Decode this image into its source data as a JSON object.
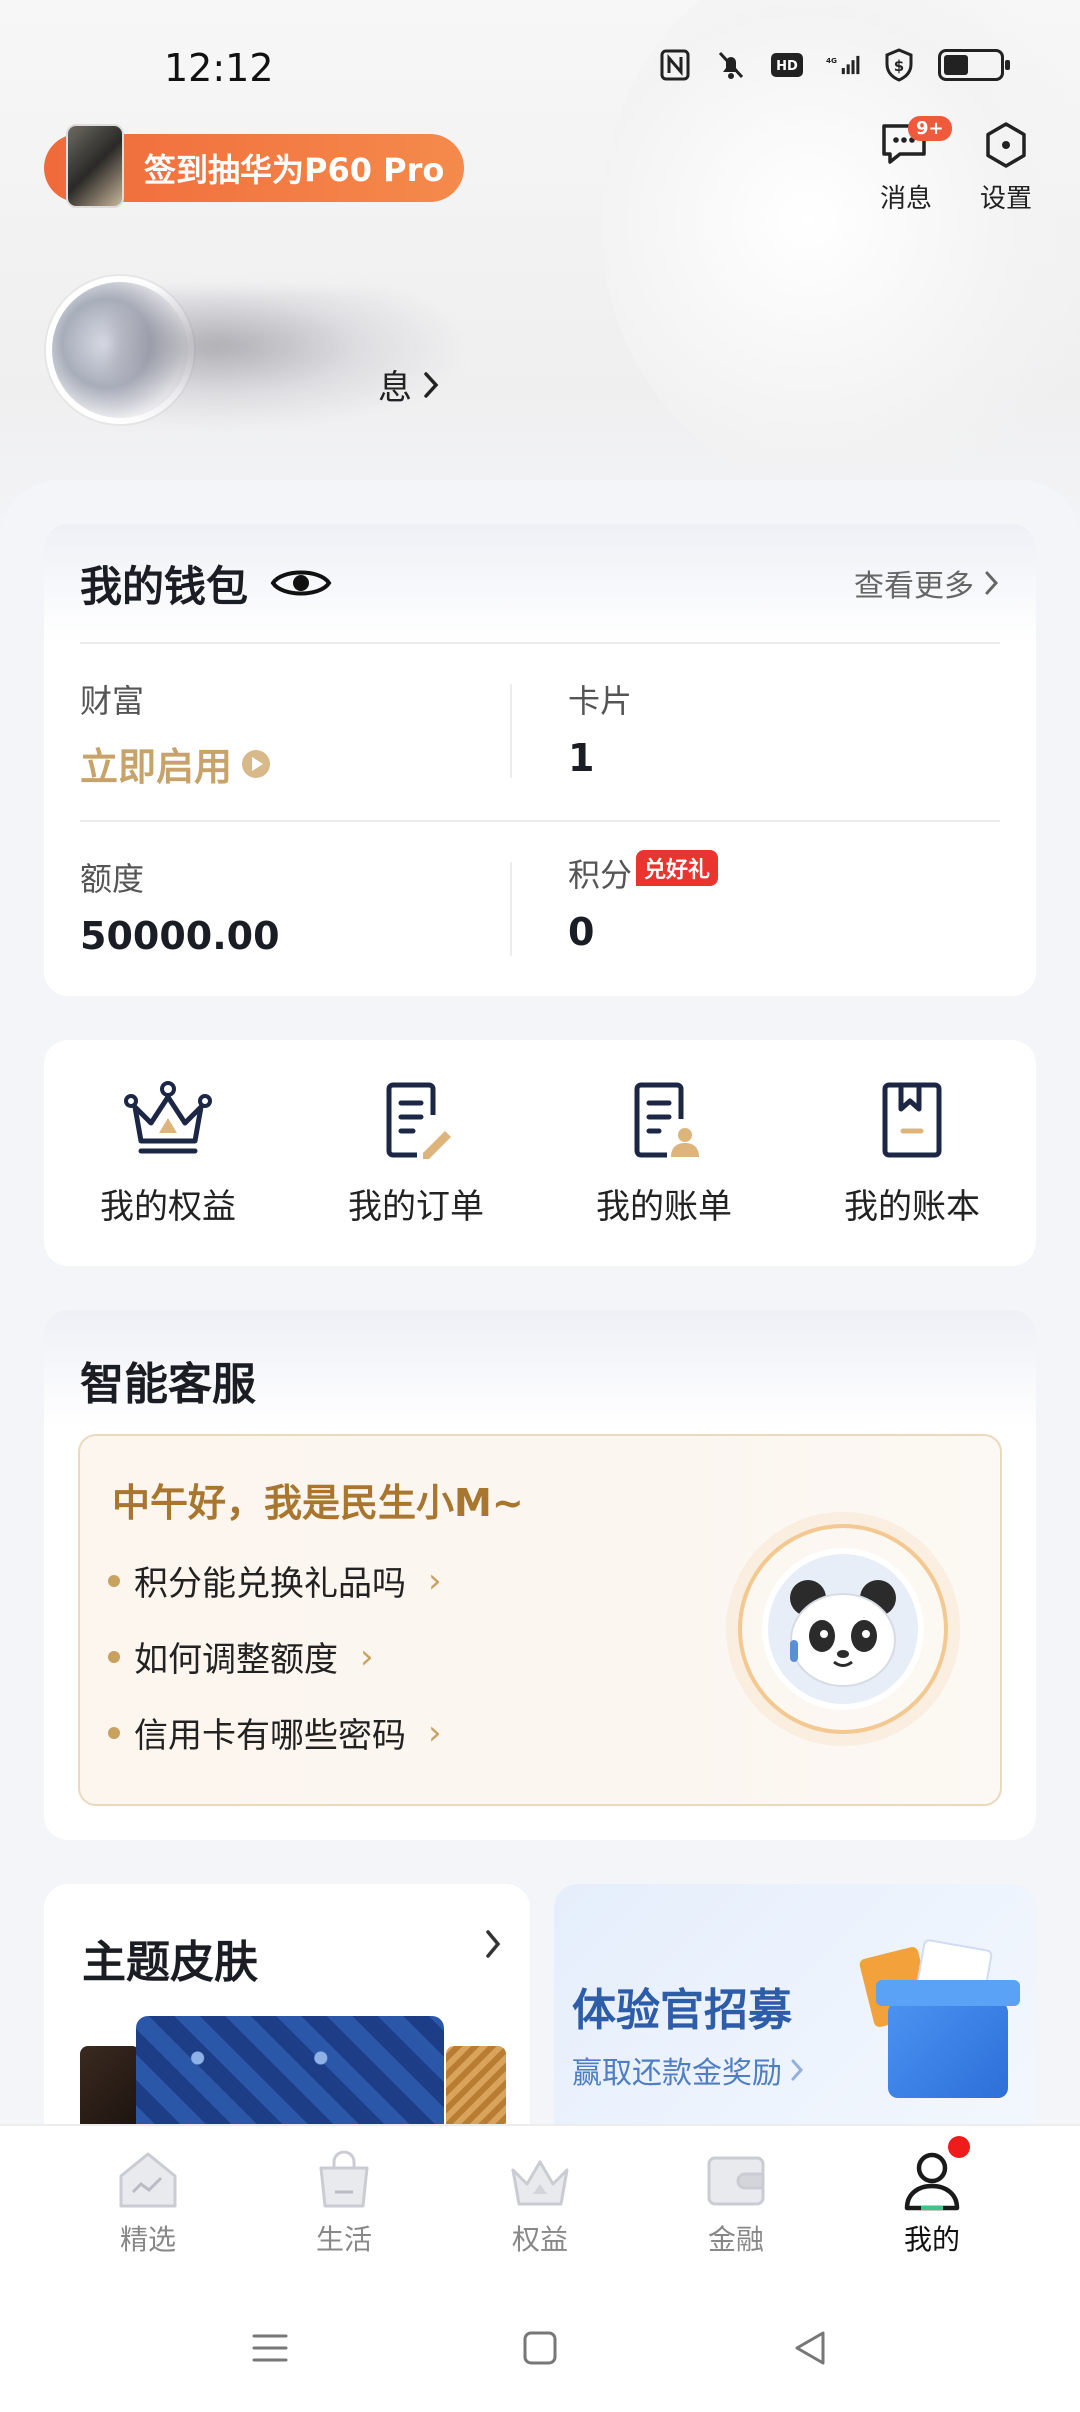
{
  "status_bar": {
    "time": "12:12",
    "network": "4G"
  },
  "promo": {
    "label": "签到抽华为P60 Pro"
  },
  "top_actions": {
    "messages_label": "消息",
    "messages_badge": "9+",
    "settings_label": "设置"
  },
  "profile": {
    "link_label": "息"
  },
  "wallet": {
    "title": "我的钱包",
    "see_more": "查看更多",
    "wealth_label": "财富",
    "wealth_value": "立即启用",
    "card_label": "卡片",
    "card_value": "1",
    "limit_label": "额度",
    "limit_value": "50000.00",
    "points_label": "积分",
    "points_tag": "兑好礼",
    "points_value": "0"
  },
  "shortcuts": [
    {
      "label": "我的权益",
      "icon": "crown-icon"
    },
    {
      "label": "我的订单",
      "icon": "order-edit-icon"
    },
    {
      "label": "我的账单",
      "icon": "bill-user-icon"
    },
    {
      "label": "我的账本",
      "icon": "ledger-icon"
    }
  ],
  "service": {
    "title": "智能客服",
    "greeting": "中午好，我是民生小M~",
    "questions": [
      "积分能兑换礼品吗",
      "如何调整额度",
      "信用卡有哪些密码"
    ]
  },
  "theme": {
    "title": "主题皮肤"
  },
  "recruit": {
    "title": "体验官招募",
    "subtitle": "赢取还款金奖励"
  },
  "bottom_nav": [
    {
      "label": "精选",
      "icon": "home-icon",
      "active": false
    },
    {
      "label": "生活",
      "icon": "shopping-bag-icon",
      "active": false
    },
    {
      "label": "权益",
      "icon": "crown-icon",
      "active": false
    },
    {
      "label": "金融",
      "icon": "wallet-icon",
      "active": false
    },
    {
      "label": "我的",
      "icon": "person-icon",
      "active": true
    }
  ],
  "colors": {
    "accent_gold": "#c7a36a",
    "promo_orange": "#f06a3a",
    "badge_red": "#e9342f",
    "recruit_blue": "#2d5ca8"
  }
}
